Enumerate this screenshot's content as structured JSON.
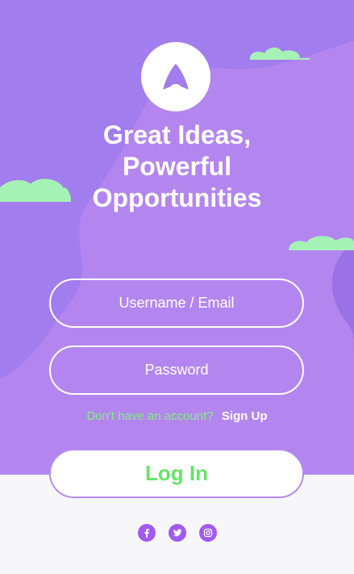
{
  "headline": {
    "line1": "Great Ideas,",
    "line2": "Powerful",
    "line3": "Opportunities"
  },
  "form": {
    "username_placeholder": "Username / Email",
    "password_placeholder": "Password",
    "signup_prompt": "Don't have an account?",
    "signup_link": "Sign Up",
    "login_label": "Log In"
  },
  "social": {
    "icons": [
      "facebook-icon",
      "twitter-icon",
      "instagram-icon"
    ]
  },
  "colors": {
    "hero_background": "#a27ded",
    "wave_background": "#b386ef",
    "cloud": "#a6f2b6",
    "accent_green": "#66e466",
    "social_purple": "#a259f0",
    "footer_background": "#f7f7f9"
  }
}
